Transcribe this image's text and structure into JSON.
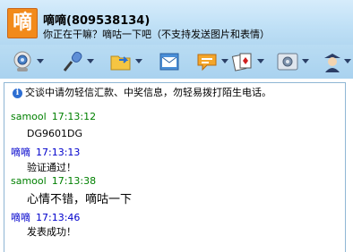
{
  "colors": {
    "self_name": "#0000cc",
    "other_name": "#008000",
    "avatar_bg": "#f28a1a"
  },
  "header": {
    "avatar_glyph": "嘀",
    "contact_name": "嘀嘀(809538134)",
    "signature": "你正在干嘛？嘀咕一下吧（不支持发送图片和表情）"
  },
  "toolbar": {
    "tools": [
      {
        "icon": "video-camera-icon"
      },
      {
        "icon": "microphone-icon"
      },
      {
        "icon": "send-file-folder-icon"
      },
      {
        "icon": "email-icon"
      },
      {
        "icon": "chat-bubble-icon"
      },
      {
        "icon": "game-cards-icon"
      },
      {
        "icon": "settings-icon"
      },
      {
        "icon": "agent-icon"
      }
    ]
  },
  "chat": {
    "notice": "交谈中请勿轻信汇款、中奖信息，勿轻易拨打陌生电话。",
    "messages": [
      {
        "sender": "samool",
        "time": "17:13:12",
        "text": "DG9601DG"
      },
      {
        "sender": "嘀嘀",
        "time": "17:13:13",
        "text": "验证通过！"
      },
      {
        "sender": "samool",
        "time": "17:13:38",
        "text": "心情不错，嘀咕一下"
      },
      {
        "sender": "嘀嘀",
        "time": "17:13:46",
        "text": "发表成功！"
      }
    ]
  }
}
